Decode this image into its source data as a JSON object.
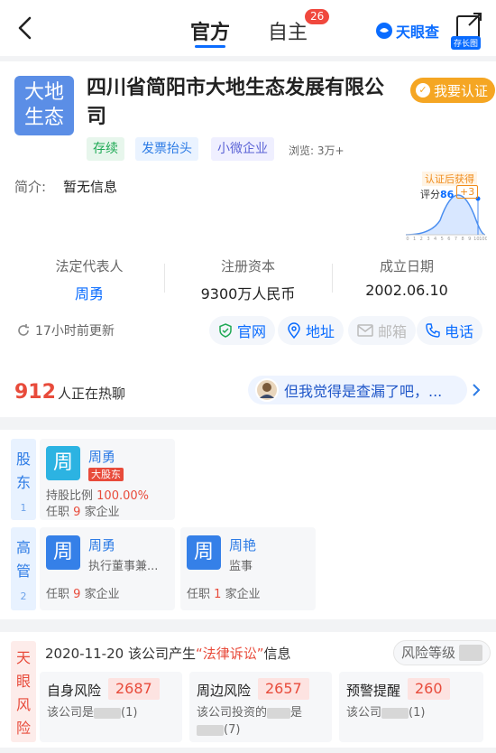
{
  "nav": {
    "tab_official": "官方",
    "tab_self": "自主",
    "tab_self_badge": "26",
    "logo_text": "天眼查",
    "longshot_label": "存长图"
  },
  "company": {
    "logo_text": "大地生态",
    "name": "四川省简阳市大地生态发展有限公司",
    "verify_label": "我要认证",
    "tags": [
      "存续",
      "发票抬头",
      "小微企业"
    ],
    "views": "浏览: 3万+",
    "intro_label": "简介:",
    "intro_value": "暂无信息"
  },
  "score": {
    "title": "认证后获得",
    "label": "评分",
    "value": "86",
    "plus": "+3",
    "ticks": [
      "0",
      "1",
      "2",
      "3",
      "4",
      "5",
      "6",
      "7",
      "8",
      "9",
      "10",
      "100"
    ]
  },
  "stats": [
    {
      "label": "法定代表人",
      "value": "周勇"
    },
    {
      "label": "注册资本",
      "value": "9300万人民币"
    },
    {
      "label": "成立日期",
      "value": "2002.06.10"
    }
  ],
  "update": {
    "text": "17小时前更新",
    "website": "官网",
    "address": "地址",
    "email": "邮箱",
    "phone": "电话"
  },
  "hot": {
    "count": "912",
    "text": "人正在热聊",
    "chat": "但我觉得是查漏了吧，..."
  },
  "shareholders": {
    "label": "股东",
    "count": "1",
    "items": [
      {
        "avatar": "周",
        "name": "周勇",
        "tag": "大股东",
        "ratio_label": "持股比例",
        "ratio": "100.00%",
        "jobs_prefix": "任职",
        "jobs": "9",
        "jobs_suffix": "家企业"
      }
    ]
  },
  "management": {
    "label": "高管",
    "count": "2",
    "items": [
      {
        "avatar": "周",
        "name": "周勇",
        "role": "执行董事兼...",
        "jobs_prefix": "任职",
        "jobs": "9",
        "jobs_suffix": "家企业"
      },
      {
        "avatar": "周",
        "name": "周艳",
        "role": "监事",
        "jobs_prefix": "任职",
        "jobs": "1",
        "jobs_suffix": "家企业"
      }
    ]
  },
  "risk": {
    "side_label": "天眼风险",
    "date": "2020-11-20",
    "title_mid": "该公司产生",
    "title_highlight": "“法律诉讼”",
    "title_end": "信息",
    "level_label": "风险等级",
    "cards": [
      {
        "label": "自身风险",
        "count": "2687",
        "desc_a": "该公司是",
        "desc_b": "(1)"
      },
      {
        "label": "周边风险",
        "count": "2657",
        "desc_a": "该公司投资的",
        "desc_b": "是",
        "desc_c": "(7)"
      },
      {
        "label": "预警提醒",
        "count": "260",
        "desc_a": "该公司",
        "desc_b": "(1)"
      }
    ]
  },
  "colors": {
    "accent": "#0a6cff",
    "risk": "#e84b3b",
    "verify": "#f5a623"
  }
}
